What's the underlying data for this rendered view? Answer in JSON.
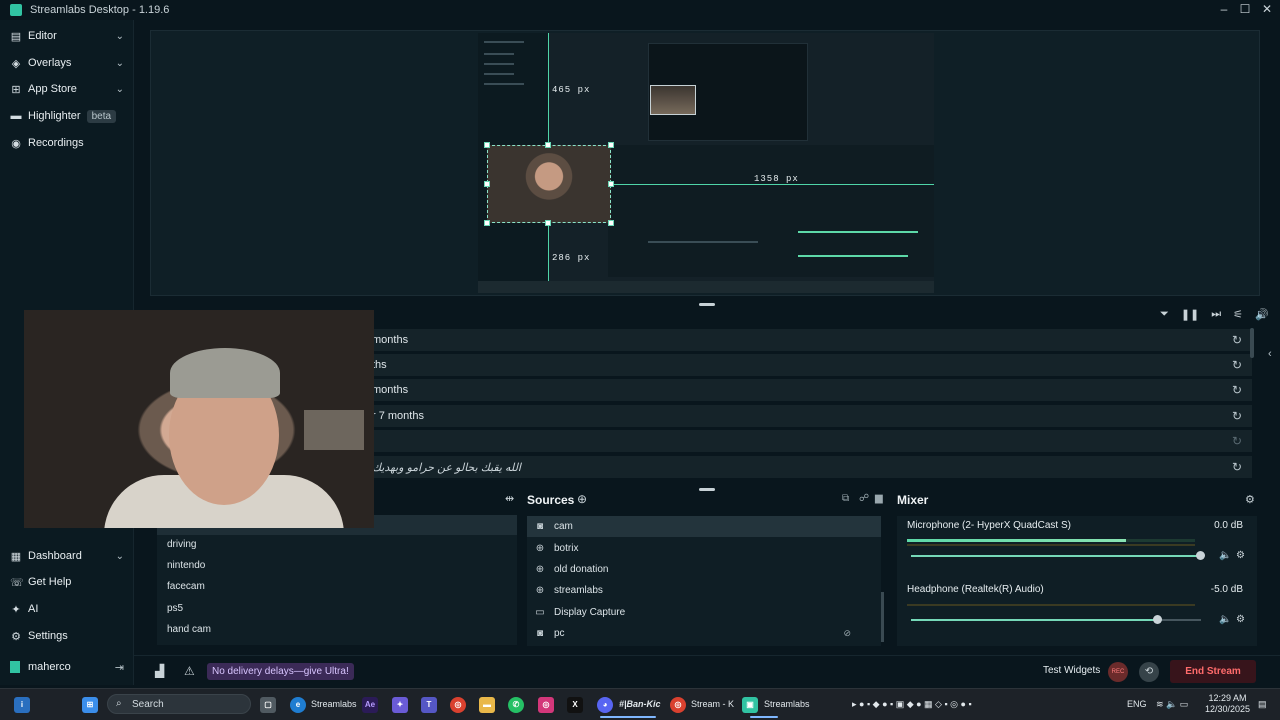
{
  "window": {
    "title": "Streamlabs Desktop - 1.19.6"
  },
  "sidebar": {
    "items": [
      {
        "label": "Editor",
        "icon": "editor-icon"
      },
      {
        "label": "Overlays",
        "icon": "overlays-icon"
      },
      {
        "label": "App Store",
        "icon": "app-store-icon"
      },
      {
        "label": "Highlighter",
        "icon": "highlighter-icon",
        "badge": "beta"
      },
      {
        "label": "Recordings",
        "icon": "recordings-icon"
      }
    ],
    "bottom_items": [
      {
        "label": "Dashboard",
        "icon": "dashboard-icon"
      },
      {
        "label": "Get Help",
        "icon": "help-icon"
      },
      {
        "label": "AI",
        "icon": "ai-icon"
      },
      {
        "label": "Settings",
        "icon": "settings-icon"
      }
    ],
    "user": {
      "name": "maherco"
    }
  },
  "preview": {
    "measure_top": "465 px",
    "measure_right": "1358 px",
    "measure_bottom": "286 px"
  },
  "events": {
    "rows": [
      {
        "text": "months"
      },
      {
        "text": "ths"
      },
      {
        "text": "months"
      },
      {
        "text": "r 7 months"
      },
      {
        "text": ""
      },
      {
        "text": "الله يقبك بحالو عن حرامو وبهديك"
      }
    ]
  },
  "scenes": {
    "items": [
      "driving",
      "nintendo",
      "facecam",
      "ps5",
      "hand cam"
    ]
  },
  "sources": {
    "title": "Sources",
    "items": [
      {
        "label": "cam",
        "icon": "webcam-icon"
      },
      {
        "label": "botrix",
        "icon": "globe-icon"
      },
      {
        "label": "old donation",
        "icon": "globe-icon"
      },
      {
        "label": "streamlabs",
        "icon": "globe-icon"
      },
      {
        "label": "Display Capture",
        "icon": "monitor-icon"
      },
      {
        "label": "pc",
        "icon": "webcam-icon"
      }
    ]
  },
  "mixer": {
    "title": "Mixer",
    "channels": [
      {
        "name": "Microphone (2- HyperX QuadCast S)",
        "db": "0.0 dB",
        "meter": 0.76,
        "volume": 1.0
      },
      {
        "name": "Headphone (Realtek(R) Audio)",
        "db": "-5.0 dB",
        "meter": 0.0,
        "volume": 0.85
      }
    ]
  },
  "footer": {
    "promo": "No delivery delays—give Ultra!",
    "test_widgets": "Test Widgets",
    "rec_label": "REC",
    "end_stream": "End Stream"
  },
  "taskbar": {
    "search_placeholder": "Search",
    "apps": [
      "Streamlabs",
      "#|Ban-Kic",
      "Stream - K",
      "Streamlabs"
    ],
    "lang": "ENG",
    "time": "12:29 AM",
    "date": "12/30/2025"
  },
  "colors": {
    "accent": "#31c3a2",
    "end_stream": "#ff6b6b",
    "promo_bg": "#3b2a57"
  }
}
